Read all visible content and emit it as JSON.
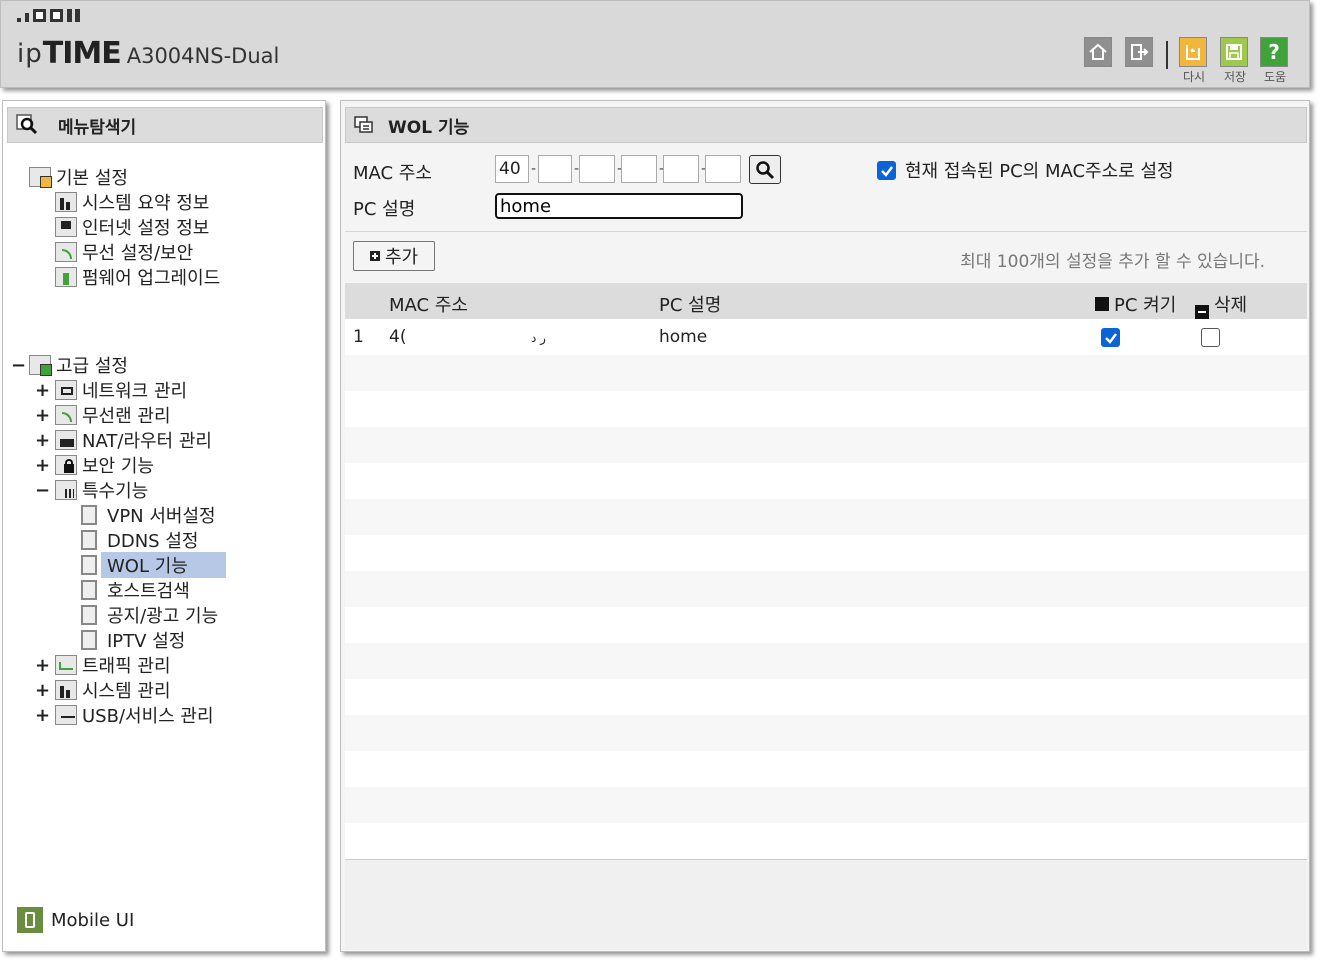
{
  "header": {
    "brand_ip": "ip",
    "brand_time": "TIME",
    "model": "A3004NS-Dual",
    "buttons": {
      "reload_label": "다시",
      "save_label": "저장",
      "help_label": "도움"
    },
    "colors": {
      "reload": "#f1b73d",
      "save": "#9fc94c",
      "help": "#3fa23a"
    }
  },
  "sidebar": {
    "title": "메뉴탐색기",
    "basic": {
      "label": "기본 설정",
      "items": [
        "시스템 요약 정보",
        "인터넷 설정 정보",
        "무선 설정/보안",
        "펌웨어 업그레이드"
      ]
    },
    "advanced": {
      "label": "고급 설정",
      "items": [
        "네트워크 관리",
        "무선랜 관리",
        "NAT/라우터 관리",
        "보안 기능",
        "특수기능"
      ],
      "special_items": [
        "VPN 서버설정",
        "DDNS 설정",
        "WOL 기능",
        "호스트검색",
        "공지/광고 기능",
        "IPTV 설정"
      ],
      "more_items": [
        "트래픽 관리",
        "시스템 관리",
        "USB/서비스 관리"
      ]
    },
    "mobile_ui": "Mobile UI"
  },
  "main": {
    "title": "WOL 기능",
    "form": {
      "mac_label": "MAC 주소",
      "mac_first_octet": "40",
      "mac_separators": [
        "-",
        "-",
        "-",
        "-",
        "-"
      ],
      "pc_label": "PC 설명",
      "pc_value": "home",
      "use_current_label": "현재 접속된 PC의 MAC주소로 설정",
      "use_current_checked": true
    },
    "add_button": "추가",
    "limit_text": "최대 100개의 설정을 추가 할 수 있습니다.",
    "table": {
      "headers": {
        "mac": "MAC 주소",
        "pc": "PC 설명",
        "wake": "PC 켜기",
        "delete": "삭제"
      },
      "rows": [
        {
          "index": "1",
          "mac": "4(",
          "mac_tail": "ر د",
          "pc": "home",
          "wake": true,
          "delete": false
        }
      ]
    }
  }
}
